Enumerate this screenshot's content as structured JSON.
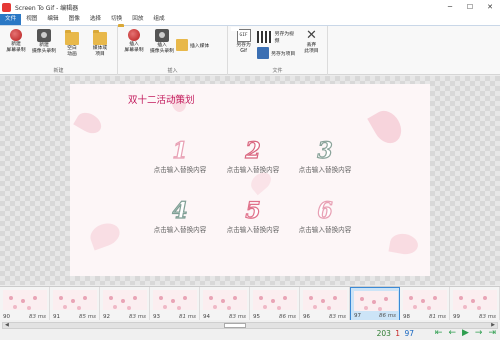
{
  "window": {
    "title": "Screen To Gif - 编辑器",
    "minimize": "─",
    "maximize": "☐",
    "close": "✕"
  },
  "menu": {
    "tabs": [
      "文件",
      "视图",
      "编辑",
      "图像",
      "选择",
      "切换",
      "回放",
      "组成"
    ]
  },
  "ribbon": {
    "groups": [
      {
        "label": "新建",
        "buttons": [
          {
            "label": "新建\n屏幕录制",
            "icon": "record-icon"
          },
          {
            "label": "新建\n摄像头录制",
            "icon": "webcam-icon"
          },
          {
            "label": "空白\n动画",
            "icon": "blank-folder-icon"
          },
          {
            "label": "媒体或\n项目",
            "icon": "media-folder-icon"
          }
        ]
      },
      {
        "label": "插入",
        "buttons": [
          {
            "label": "插入\n屏幕录制",
            "icon": "record-icon"
          },
          {
            "label": "插入\n摄像头录制",
            "icon": "webcam-icon"
          },
          {
            "label": "插入媒体",
            "icon": "insert-media-icon"
          }
        ]
      },
      {
        "label": "文件",
        "buttons": [
          {
            "label": "另存为\nGif",
            "icon": "gif-icon"
          },
          {
            "label": "另存为视频",
            "icon": "video-icon"
          },
          {
            "label": "另存为项目",
            "icon": "project-disk-icon"
          },
          {
            "label": "丢弃\n此项目",
            "icon": "discard-icon"
          }
        ]
      }
    ]
  },
  "slide": {
    "title": "双十二活动策划",
    "items": [
      {
        "num": "1",
        "text": "点击输入替换内容",
        "color": "#e8a0b4"
      },
      {
        "num": "2",
        "text": "点击输入替换内容",
        "color": "#d9667f"
      },
      {
        "num": "3",
        "text": "点击输入替换内容",
        "color": "#8aa39a"
      },
      {
        "num": "4",
        "text": "点击输入替换内容",
        "color": "#7f9f95"
      },
      {
        "num": "5",
        "text": "点击输入替换内容",
        "color": "#e0708a"
      },
      {
        "num": "6",
        "text": "点击输入替换内容",
        "color": "#e8a0b4"
      }
    ]
  },
  "filmstrip": {
    "frames": [
      {
        "index": "90",
        "ms": "83 ms"
      },
      {
        "index": "91",
        "ms": "85 ms"
      },
      {
        "index": "92",
        "ms": "83 ms"
      },
      {
        "index": "93",
        "ms": "81 ms"
      },
      {
        "index": "94",
        "ms": "83 ms"
      },
      {
        "index": "95",
        "ms": "86 ms"
      },
      {
        "index": "96",
        "ms": "83 ms"
      },
      {
        "index": "97",
        "ms": "86 ms",
        "selected": true
      },
      {
        "index": "98",
        "ms": "81 ms"
      },
      {
        "index": "99",
        "ms": "83 ms"
      }
    ]
  },
  "status": {
    "total_frames": "203",
    "selected_count": "1",
    "current_frame": "97"
  },
  "colors": {
    "accent": "#2b78c5",
    "title": "#c2185b",
    "nav": "#2e9e4f"
  }
}
